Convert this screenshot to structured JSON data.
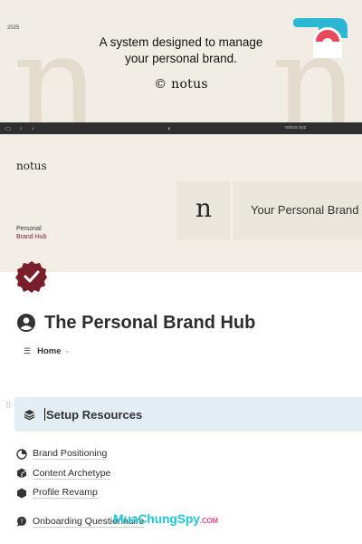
{
  "promo": {
    "year": "2025",
    "tagline": "A system designed to manage your personal brand.",
    "brand": "© notus",
    "bg_letter": "n",
    "badge_icon": "eye-logo-icon",
    "badge_colors": {
      "teal": "#2bb7d3",
      "red": "#e8495b"
    }
  },
  "browser": {
    "sidebar_icon": "sidebar-toggle-icon",
    "back_icon": "chevron-left-icon",
    "forward_icon": "chevron-right-icon",
    "privacy_icon": "shield-half-icon",
    "url": "notus.xyz"
  },
  "cover": {
    "wordmark": "notus",
    "tile_letter": "n",
    "tile_title": "Your Personal Brand",
    "side_label_1": "Personal",
    "side_label_2": "Brand Hub"
  },
  "page": {
    "icon": "checkmark-seal-icon",
    "title_icon": "user-circle-icon",
    "title": "The Personal Brand Hub",
    "home_label": "Home",
    "accent": "#7a1e2c"
  },
  "callout": {
    "icon": "layers-icon",
    "label": "Setup Resources",
    "background": "#e2eef4"
  },
  "links": [
    {
      "label": "Brand Positioning",
      "icon": "pie-chart-icon"
    },
    {
      "label": "Content Archetype",
      "icon": "cube-icon"
    },
    {
      "label": "Profile Revamp",
      "icon": "hexagon-icon"
    },
    {
      "label": "Onboarding Questionnaire",
      "icon": "chat-bubble-icon"
    }
  ],
  "watermark": {
    "main": "MuaChungSpy",
    "suffix": ".COM"
  }
}
